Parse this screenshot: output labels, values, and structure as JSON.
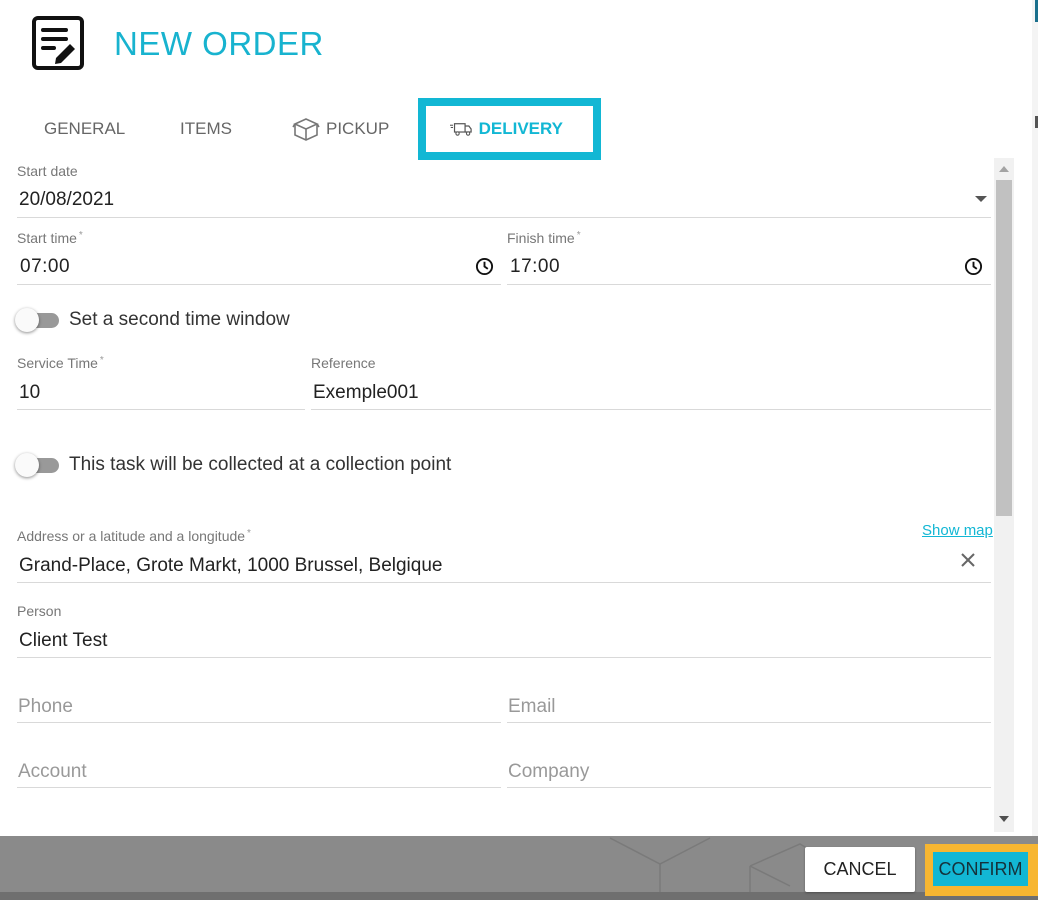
{
  "header": {
    "title": "NEW ORDER"
  },
  "tabs": [
    {
      "label": "GENERAL"
    },
    {
      "label": "ITEMS"
    },
    {
      "label": "PICKUP"
    },
    {
      "label": "DELIVERY"
    }
  ],
  "form": {
    "start_date": {
      "label": "Start date",
      "value": "20/08/2021"
    },
    "start_time": {
      "label": "Start time",
      "required": "*",
      "value": "07:00"
    },
    "finish_time": {
      "label": "Finish time",
      "required": "*",
      "value": "17:00"
    },
    "second_window_toggle": {
      "label": "Set a second time window"
    },
    "service_time": {
      "label": "Service Time",
      "required": "*",
      "value": "10"
    },
    "reference": {
      "label": "Reference",
      "value": "Exemple001"
    },
    "collection_toggle": {
      "label": "This task will be collected at a collection point"
    },
    "address": {
      "label": "Address or a latitude and a longitude",
      "required": "*",
      "value": "Grand-Place, Grote Markt, 1000 Brussel, Belgique",
      "link": "Show map"
    },
    "person": {
      "label": "Person",
      "value": "Client Test"
    },
    "phone": {
      "placeholder": "Phone"
    },
    "email": {
      "placeholder": "Email"
    },
    "account": {
      "placeholder": "Account"
    },
    "company": {
      "placeholder": "Company"
    }
  },
  "footer": {
    "cancel_label": "CANCEL",
    "confirm_label": "CONFIRM"
  },
  "colors": {
    "accent": "#12b7d4",
    "highlight": "#f7b631"
  }
}
